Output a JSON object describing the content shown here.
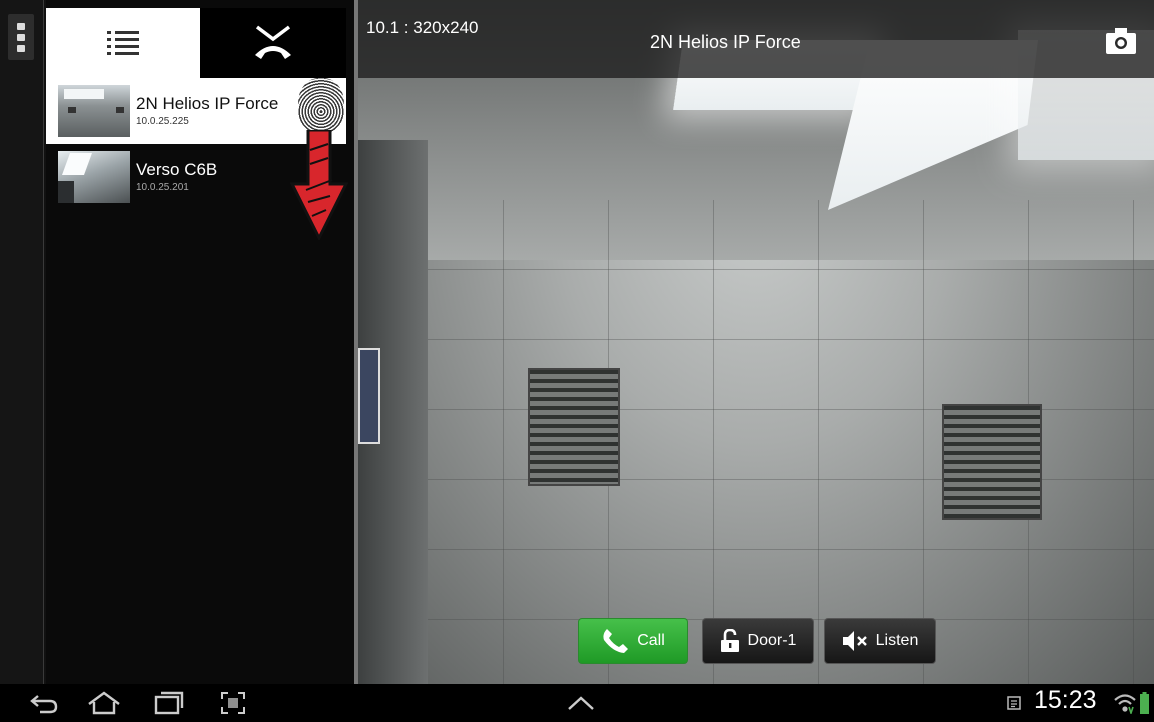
{
  "sidebar": {
    "devices": [
      {
        "name": "2N Helios IP Force",
        "ip": "10.0.25.225",
        "selected": true
      },
      {
        "name": "Verso C6B",
        "ip": "10.0.25.201",
        "selected": false
      }
    ]
  },
  "camera": {
    "resolution": "10.1 : 320x240",
    "title": "2N Helios IP Force"
  },
  "controls": {
    "call_label": "Call",
    "door_label": "Door-1",
    "listen_label": "Listen"
  },
  "status_bar": {
    "time": "15:23"
  },
  "colors": {
    "call_green": "#2eae33",
    "swipe_arrow_red": "#d8262c"
  },
  "icons": [
    "overflow-menu-icon",
    "list-icon",
    "hang-up-icon",
    "camera-snapshot-icon",
    "phone-icon",
    "padlock-open-icon",
    "speaker-muted-icon",
    "back-icon",
    "home-icon",
    "recent-apps-icon",
    "screenshot-icon",
    "up-chevron-icon",
    "notification-icon",
    "wifi-icon",
    "battery-icon"
  ]
}
